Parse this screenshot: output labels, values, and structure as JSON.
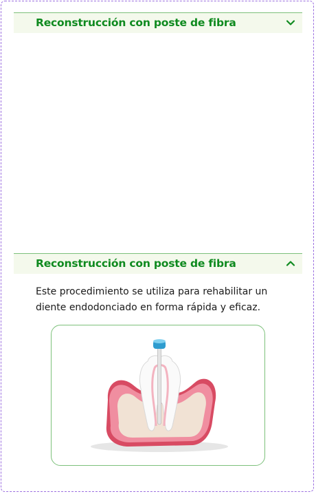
{
  "sections": [
    {
      "title": "Reconstrucción con poste de fibra",
      "state": "collapsed",
      "chevron_icon": "chevron-down-icon"
    },
    {
      "title": "Reconstrucción con poste de fibra",
      "state": "expanded",
      "chevron_icon": "chevron-up-icon",
      "description": "Este procedimiento se utiliza para rehabilitar un diente endodonciado en forma rápida y eficaz.",
      "image_icon": "tooth-fiber-post-illustration"
    }
  ],
  "colors": {
    "accent": "#0f8a1f",
    "header_bg": "#f4f9ec",
    "border": "#7cc07a",
    "frame": "#9b6ee0"
  }
}
